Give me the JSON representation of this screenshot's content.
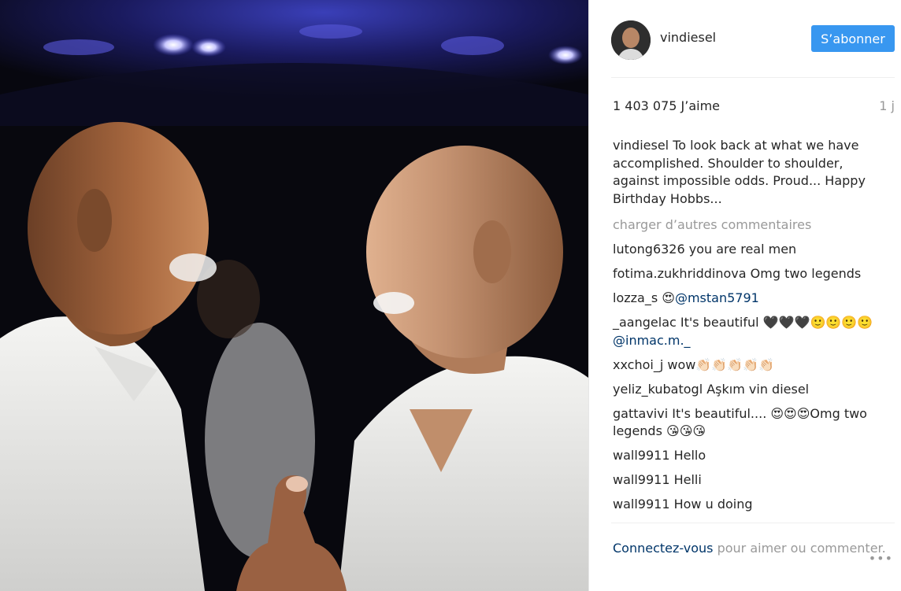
{
  "post": {
    "username": "vindiesel",
    "follow_label": "S’abonner",
    "likes": "1 403 075 J’aime",
    "age": "1 j",
    "caption": {
      "user": "vindiesel",
      "text": "To look back at what we have accomplished. Shoulder to shoulder, against impossible odds. Proud... Happy Birthday Hobbs..."
    },
    "load_more": "charger d’autres commentaires",
    "comments": [
      {
        "user": "lutong6326",
        "text": "you are real men",
        "mention": ""
      },
      {
        "user": "fotima.zukhriddinova",
        "text": "Omg two legends",
        "mention": ""
      },
      {
        "user": "lozza_s",
        "text": "😍",
        "mention": "@mstan5791"
      },
      {
        "user": "_aangelac",
        "text": "It's beautiful 🖤🖤🖤🙂🙂🙂🙂",
        "mention": "@inmac.m._"
      },
      {
        "user": "xxchoi_j",
        "text": "wow👏🏻👏🏻👏🏻👏🏻👏🏻",
        "mention": ""
      },
      {
        "user": "yeliz_kubatogl",
        "text": "Aşkım vin diesel",
        "mention": ""
      },
      {
        "user": "gattavivi",
        "text": "It's beautiful.... 😍😍😍Omg two legends 😘😘😘",
        "mention": ""
      },
      {
        "user": "wall9911",
        "text": "Hello",
        "mention": ""
      },
      {
        "user": "wall9911",
        "text": "Helli",
        "mention": ""
      },
      {
        "user": "wall9911",
        "text": "How u doing",
        "mention": ""
      }
    ],
    "footer": {
      "login_link": "Connectez-vous",
      "login_text": "pour aimer ou commenter.",
      "more_icon": "•••"
    }
  },
  "colors": {
    "accent": "#3897f0",
    "link": "#003569",
    "muted": "#999999",
    "text": "#262626"
  }
}
